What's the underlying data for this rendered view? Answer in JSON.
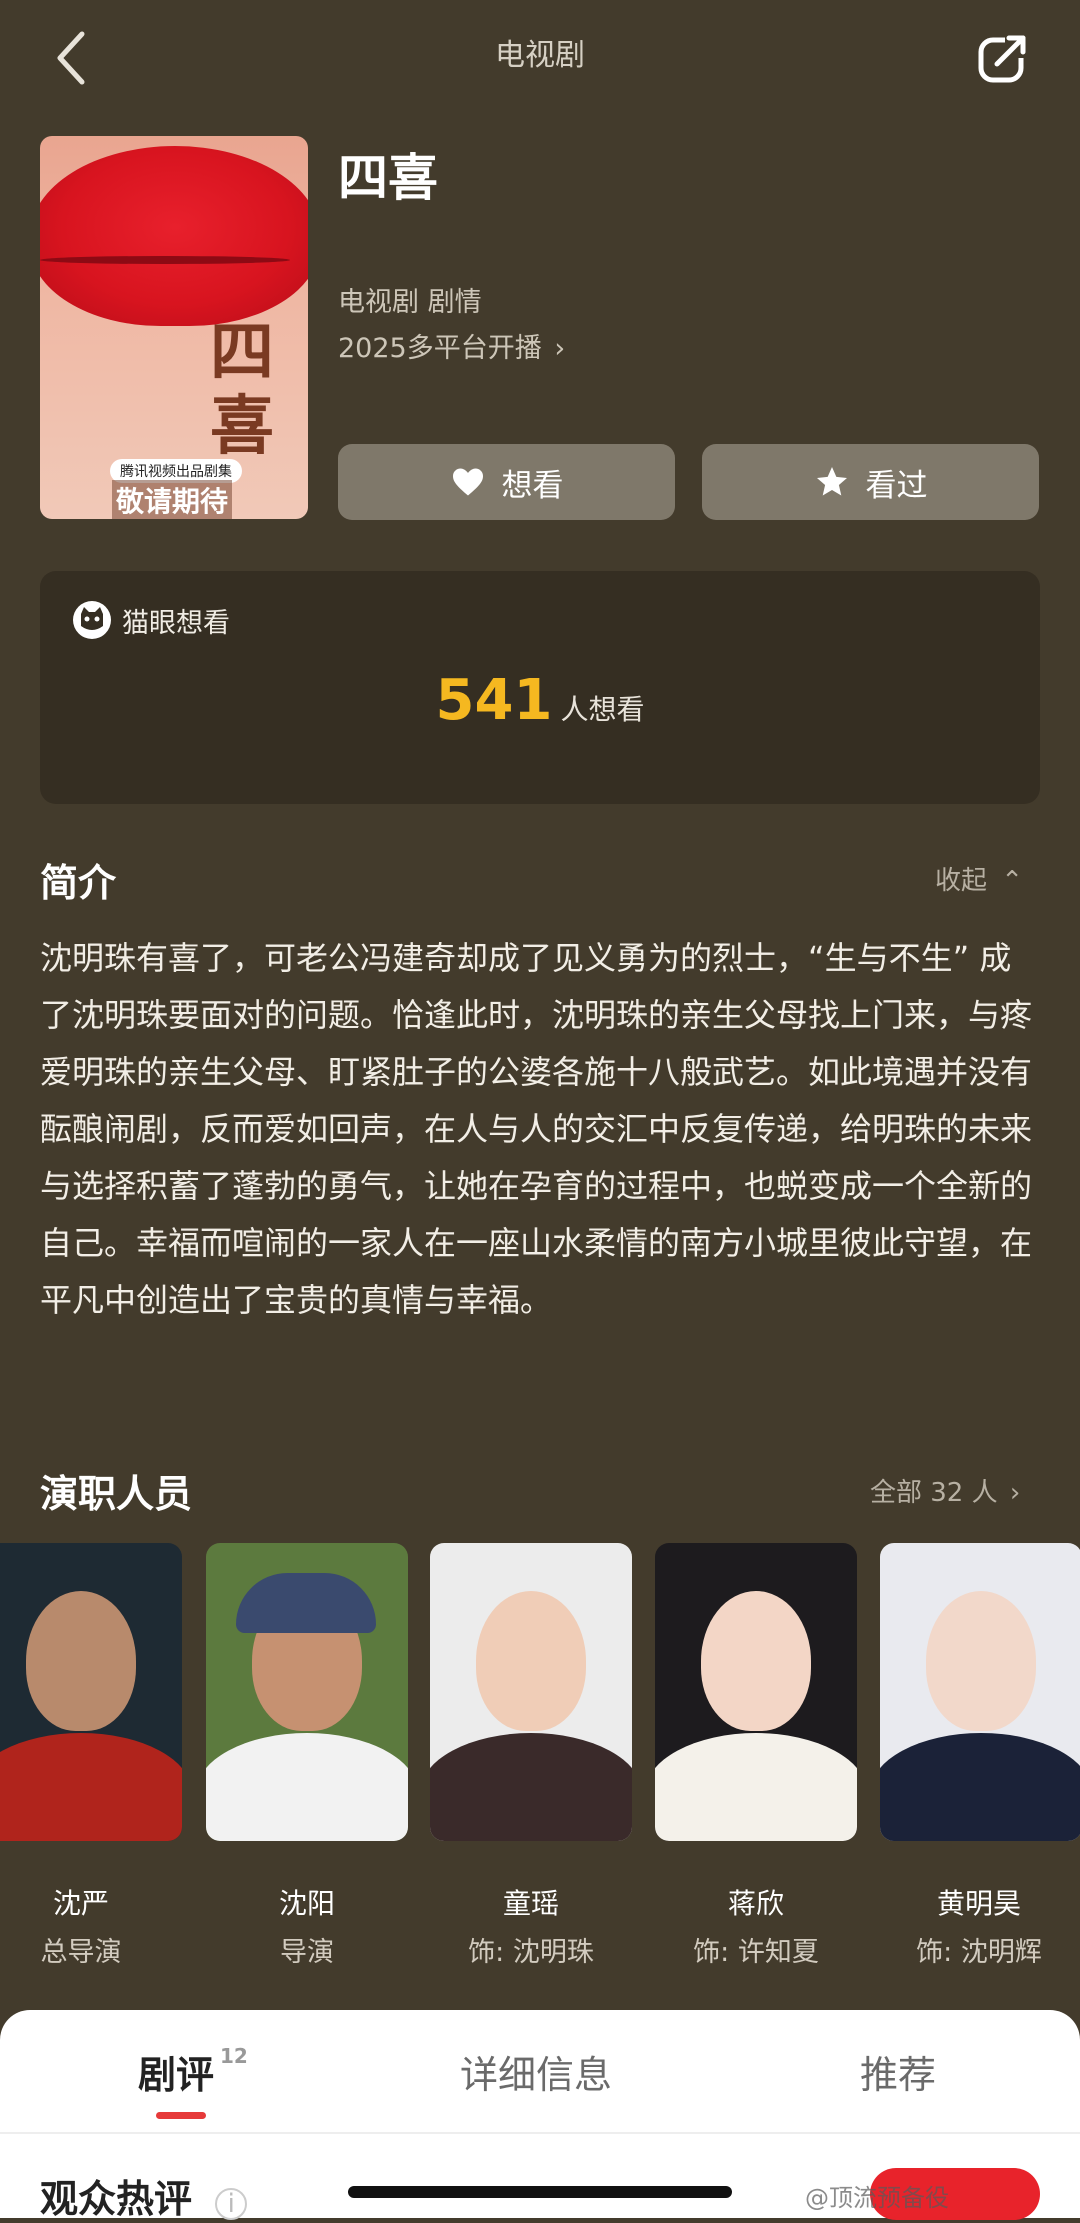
{
  "header": {
    "title": "电视剧",
    "back_icon": "chevron-left-icon",
    "share_icon": "share-icon"
  },
  "show": {
    "title": "四喜",
    "genre": "电视剧 剧情",
    "release": "2025多平台开播",
    "poster": {
      "title": "四喜",
      "tag": "腾讯视频出品剧集",
      "subtitle": "敬请期待"
    }
  },
  "actions": {
    "want_label": "想看",
    "watched_label": "看过"
  },
  "maoyan": {
    "label": "猫眼想看",
    "count": "541",
    "unit": "人想看"
  },
  "intro": {
    "heading": "简介",
    "collapse_label": "收起",
    "text": "沈明珠有喜了，可老公冯建奇却成了见义勇为的烈士，“生与不生” 成了沈明珠要面对的问题。恰逢此时，沈明珠的亲生父母找上门来，与疼爱明珠的亲生父母、盯紧肚子的公婆各施十八般武艺。如此境遇并没有酝酿闹剧，反而爱如回声，在人与人的交汇中反复传递，给明珠的未来与选择积蓄了蓬勃的勇气，让她在孕育的过程中，也蜕变成一个全新的自己。幸福而喧闹的一家人在一座山水柔情的南方小城里彼此守望，在平凡中创造出了宝贵的真情与幸福。"
  },
  "cast": {
    "heading": "演职人员",
    "all_label": "全部 32 人",
    "members": [
      {
        "name": "沈严",
        "role": "总导演"
      },
      {
        "name": "沈阳",
        "role": "导演"
      },
      {
        "name": "童瑶",
        "role": "饰: 沈明珠"
      },
      {
        "name": "蒋欣",
        "role": "饰: 许知夏"
      },
      {
        "name": "黄明昊",
        "role": "饰: 沈明辉"
      }
    ]
  },
  "tabs": [
    {
      "label": "剧评",
      "badge": "12"
    },
    {
      "label": "详细信息"
    },
    {
      "label": "推荐"
    }
  ],
  "reviews": {
    "heading": "观众热评"
  },
  "watermark": "@顶流预备役"
}
